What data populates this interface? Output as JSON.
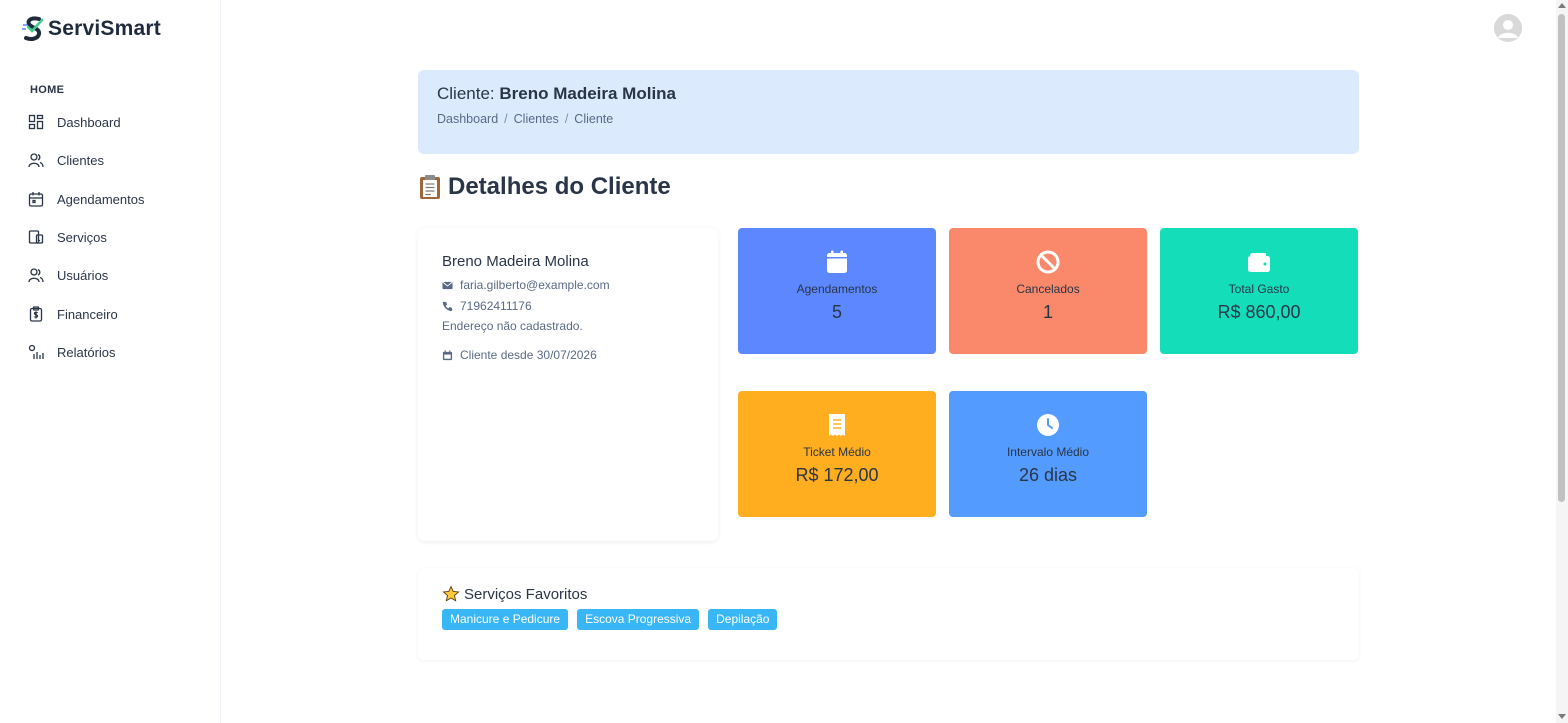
{
  "app": {
    "name": "ServiSmart"
  },
  "sidebar": {
    "header": "HOME",
    "items": [
      {
        "label": "Dashboard",
        "icon": "dashboard-icon"
      },
      {
        "label": "Clientes",
        "icon": "users-icon"
      },
      {
        "label": "Agendamentos",
        "icon": "calendar-icon"
      },
      {
        "label": "Serviços",
        "icon": "services-icon"
      },
      {
        "label": "Usuários",
        "icon": "user-icon"
      },
      {
        "label": "Financeiro",
        "icon": "money-clipboard-icon"
      },
      {
        "label": "Relatórios",
        "icon": "reports-icon"
      }
    ]
  },
  "banner": {
    "title_prefix": "Cliente: ",
    "title_name": "Breno Madeira Molina",
    "breadcrumb": [
      "Dashboard",
      "Clientes",
      "Cliente"
    ],
    "separator": "/"
  },
  "section": {
    "title": "Detalhes do Cliente"
  },
  "client": {
    "name": "Breno Madeira Molina",
    "email": "faria.gilberto@example.com",
    "phone": "71962411176",
    "address": "Endereço não cadastrado.",
    "since": "Cliente desde 30/07/2026"
  },
  "stats": [
    {
      "label": "Agendamentos",
      "value": "5",
      "color": "#5d87ff",
      "icon": "calendar-icon"
    },
    {
      "label": "Cancelados",
      "value": "1",
      "color": "#fa896b",
      "icon": "ban-icon"
    },
    {
      "label": "Total Gasto",
      "value": "R$ 860,00",
      "color": "#13deb9",
      "icon": "wallet-icon"
    },
    {
      "label": "Ticket Médio",
      "value": "R$ 172,00",
      "color": "#ffae1f",
      "icon": "receipt-icon"
    },
    {
      "label": "Intervalo Médio",
      "value": "26 dias",
      "color": "#539bff",
      "icon": "clock-icon"
    }
  ],
  "favorites": {
    "title": "Serviços Favoritos",
    "tags": [
      "Manicure e Pedicure",
      "Escova Progressiva",
      "Depilação"
    ]
  }
}
